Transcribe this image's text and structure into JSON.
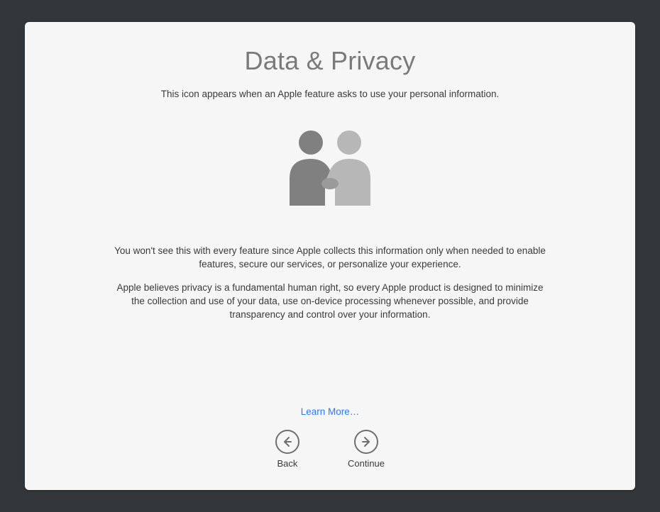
{
  "title": "Data & Privacy",
  "subtitle": "This icon appears when an Apple feature asks to use your personal information.",
  "paragraph1": "You won't see this with every feature since Apple collects this information only when needed to enable features, secure our services, or personalize your experience.",
  "paragraph2": "Apple believes privacy is a fundamental human right, so every Apple product is designed to minimize the collection and use of your data, use on-device processing whenever possible, and provide transparency and control over your information.",
  "learn_more": "Learn More…",
  "nav": {
    "back": "Back",
    "continue": "Continue"
  }
}
